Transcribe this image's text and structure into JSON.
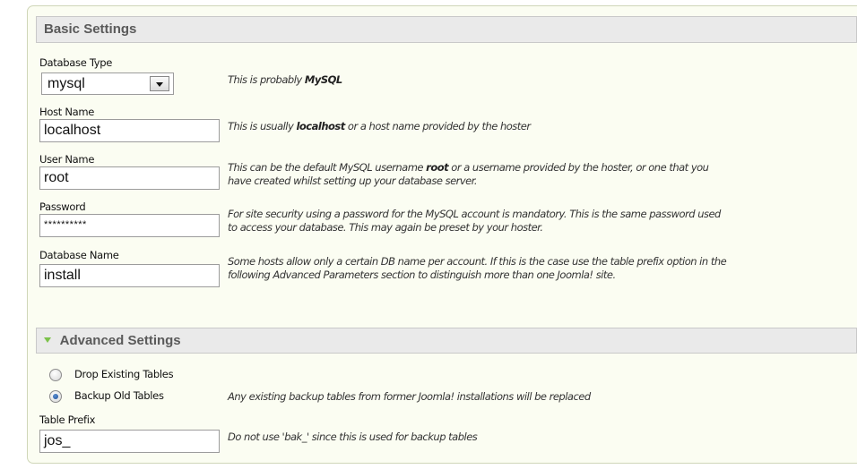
{
  "basic": {
    "title": "Basic Settings",
    "db_type": {
      "label": "Database Type",
      "value": "mysql",
      "desc_pre": "This is probably ",
      "desc_bold": "MySQL",
      "desc_post": ""
    },
    "host": {
      "label": "Host Name",
      "value": "localhost",
      "desc_pre": "This is usually ",
      "desc_bold": "localhost",
      "desc_post": " or a host name provided by the hoster"
    },
    "user": {
      "label": "User Name",
      "value": "root",
      "desc_pre": "This can be the default MySQL username ",
      "desc_bold": "root",
      "desc_post": " or a username provided by the hoster, or one that you",
      "desc_line2": "have created whilst setting up your database server."
    },
    "password": {
      "label": "Password",
      "value": "**********",
      "desc_line1": "For site security using a password for the MySQL account is mandatory. This is the same password used",
      "desc_line2": "to access your database. This may again be preset by your hoster."
    },
    "dbname": {
      "label": "Database Name",
      "value": "install",
      "desc_line1": "Some hosts allow only a certain DB name per account. If this is the case use the table prefix option in the",
      "desc_line2": "following Advanced Parameters section to distinguish more than one Joomla! site."
    }
  },
  "advanced": {
    "title": "Advanced Settings",
    "drop_label": "Drop Existing Tables",
    "backup_label": "Backup Old Tables",
    "backup_desc": "Any existing backup tables from former Joomla! installations will be replaced",
    "prefix_label": "Table Prefix",
    "prefix_value": "jos_",
    "prefix_desc": "Do not use 'bak_' since this is used for backup tables",
    "selected_option": "Backup Old Tables"
  },
  "colors": {
    "panel_bg": "#fbfdf2",
    "bar_bg": "#eaeaea",
    "accent_triangle": "#7cc24a"
  }
}
